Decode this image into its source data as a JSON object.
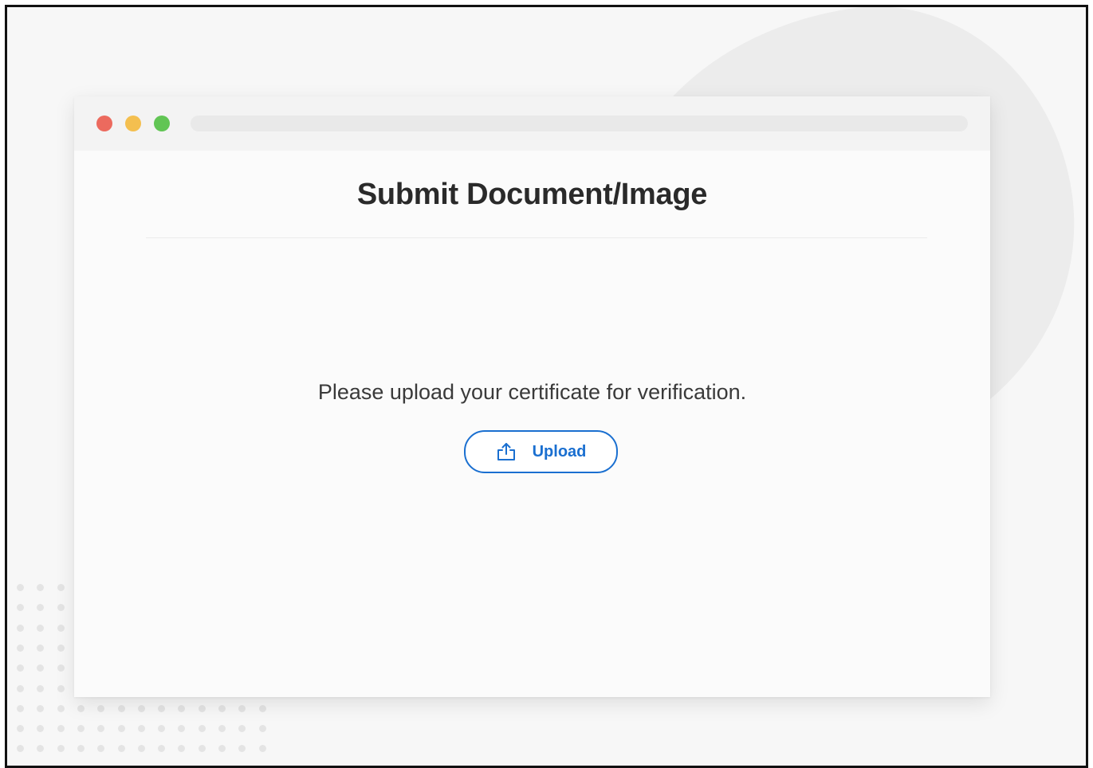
{
  "window": {
    "controls": [
      {
        "name": "close",
        "color": "#ec6a5e"
      },
      {
        "name": "minimize",
        "color": "#f4bf4f"
      },
      {
        "name": "maximize",
        "color": "#61c554"
      }
    ]
  },
  "main": {
    "title": "Submit Document/Image",
    "instruction": "Please upload your certificate for verification.",
    "upload_button": {
      "label": "Upload",
      "icon": "upload-icon"
    }
  },
  "colors": {
    "accent": "#1a6fd0",
    "title_text": "#2a2a2a",
    "body_text": "#3a3a3a"
  }
}
